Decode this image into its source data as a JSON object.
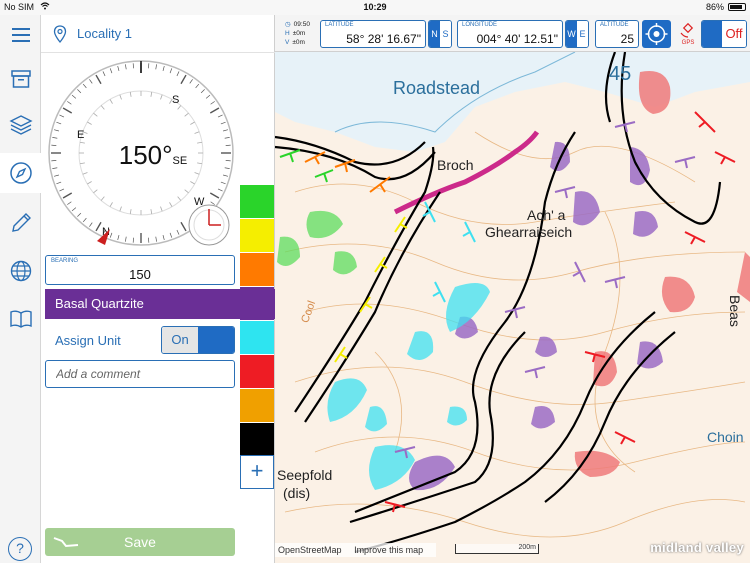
{
  "status_bar": {
    "carrier": "No SIM",
    "time": "10:29",
    "battery": "86%"
  },
  "locality": {
    "label": "Locality 1"
  },
  "compass": {
    "cardinals": {
      "n": "N",
      "e": "E",
      "s": "S",
      "w": "W"
    },
    "intercardinals": {
      "se": "SE"
    },
    "reading_degrees": "150°",
    "reading_direction": "SE",
    "needle_color": "#cc1f1f"
  },
  "bearing": {
    "caption": "BEARING",
    "value": "150"
  },
  "unit": {
    "label": "Basal Quartzite",
    "color": "#6a2f96"
  },
  "assign_unit": {
    "label": "Assign Unit",
    "toggle_label": "On"
  },
  "comment": {
    "placeholder": "Add a comment",
    "value": ""
  },
  "save": {
    "label": "Save"
  },
  "help": {
    "label": "?"
  },
  "swatches": [
    "#2ad42a",
    "#f5ee00",
    "#ff7a00",
    "#6a2f96",
    "#2ee4f0",
    "#ee1c24",
    "#f0a000",
    "#000000"
  ],
  "add_swatch": {
    "label": "+"
  },
  "gps": {
    "time": "09:50",
    "h_label": "H",
    "h_value": "±0m",
    "v_label": "V",
    "v_value": "±0m",
    "latitude_caption": "LATITUDE",
    "latitude": "58° 28' 16.67\"",
    "lat_n": "N",
    "lat_s": "S",
    "longitude_caption": "LONGITUDE",
    "longitude": "004° 40' 12.51\"",
    "lon_w": "W",
    "lon_e": "E",
    "altitude_caption": "ALTITUDE",
    "altitude": "25",
    "gps_label": "GPS",
    "gps_toggle": "Off"
  },
  "map": {
    "labels": {
      "roadstead": "Roadstead",
      "broch": "Broch",
      "achagharraiseich_1": "Ach' a",
      "achagharraiseich_2": "Ghearraiseich",
      "seepfold_1": "Seepfold",
      "seepfold_2": "(dis)",
      "grid_45": "45",
      "beas": "Beas",
      "choin": "Choin",
      "cool": "Cool"
    },
    "attribution_osm": "OpenStreetMap",
    "attribution_improve": "Improve this map",
    "scale": "200m",
    "brand": "midland valley"
  }
}
